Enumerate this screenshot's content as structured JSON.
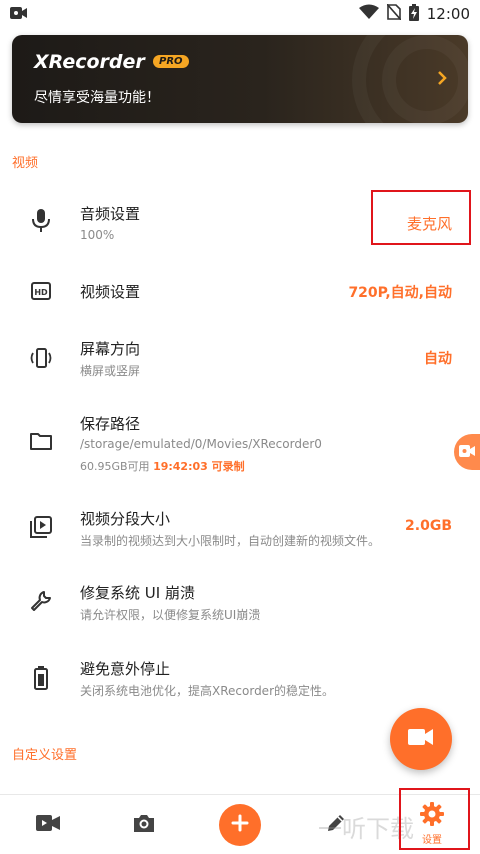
{
  "status_bar": {
    "time": "12:00"
  },
  "banner": {
    "title": "XRecorder",
    "badge": "PRO",
    "subtitle": "尽情享受海量功能！"
  },
  "sections": {
    "video": "视频",
    "custom": "自定义设置"
  },
  "settings": [
    {
      "title": "音频设置",
      "subtitle": "100%",
      "value": "麦克风",
      "icon": "microphone-icon"
    },
    {
      "title": "视频设置",
      "subtitle": "",
      "value": "720P,自动,自动",
      "icon": "hd-icon"
    },
    {
      "title": "屏幕方向",
      "subtitle": "横屏或竖屏",
      "value": "自动",
      "icon": "screen-rotation-icon"
    },
    {
      "title": "保存路径",
      "subtitle": "/storage/emulated/0/Movies/XRecorder0",
      "storage": "60.95GB可用",
      "storage_highlight": "19:42:03 可录制",
      "icon": "folder-icon"
    },
    {
      "title": "视频分段大小",
      "subtitle": "当录制的视频达到大小限制时，自动创建新的视频文件。",
      "value": "2.0GB",
      "icon": "video-library-icon"
    },
    {
      "title": "修复系统 UI 崩溃",
      "subtitle": "请允许权限，以便修复系统UI崩溃",
      "icon": "wrench-icon"
    },
    {
      "title": "避免意外停止",
      "subtitle": "关闭系统电池优化，提高XRecorder的稳定性。",
      "icon": "battery-icon"
    }
  ],
  "bottom_nav": {
    "settings_label": "设置",
    "watermark": "一听下载"
  },
  "colors": {
    "accent": "#ff6f2a",
    "banner_bg": "#1d1a17",
    "badge": "#f5a623",
    "highlight_box": "#e0151b"
  }
}
